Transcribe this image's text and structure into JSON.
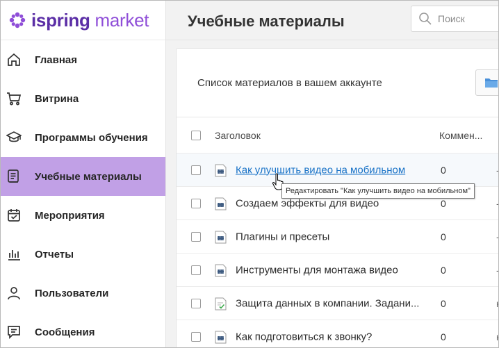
{
  "brand": {
    "logo_part1": "ispring",
    "logo_part2": " market",
    "accent": "#8f4ed8",
    "active_bg": "#c1a0e6",
    "link_color": "#1a73c7"
  },
  "sidebar": {
    "items": [
      {
        "label": "Главная",
        "icon": "home-icon"
      },
      {
        "label": "Витрина",
        "icon": "cart-icon"
      },
      {
        "label": "Программы обучения",
        "icon": "graduation-cap-icon"
      },
      {
        "label": "Учебные материалы",
        "icon": "document-icon",
        "active": true
      },
      {
        "label": "Мероприятия",
        "icon": "calendar-check-icon"
      },
      {
        "label": "Отчеты",
        "icon": "bar-chart-icon"
      },
      {
        "label": "Пользователи",
        "icon": "user-icon"
      },
      {
        "label": "Сообщения",
        "icon": "message-icon"
      }
    ]
  },
  "header": {
    "title": "Учебные материалы",
    "search_placeholder": "Поиск"
  },
  "content": {
    "subtitle": "Список материалов в вашем аккаунте",
    "columns": {
      "title": "Заголовок",
      "comments": "Коммен..."
    },
    "rows": [
      {
        "title": "Как улучшить видео на мобильном",
        "comments": "0",
        "extra": "-",
        "icon": "video-icon",
        "hover": true
      },
      {
        "title": "Создаем эффекты для видео",
        "comments": "0",
        "extra": "-",
        "icon": "video-icon"
      },
      {
        "title": "Плагины и пресеты",
        "comments": "0",
        "extra": "-",
        "icon": "video-icon"
      },
      {
        "title": "Инструменты для монтажа видео",
        "comments": "0",
        "extra": "-",
        "icon": "video-icon"
      },
      {
        "title": "Защита данных в компании. Задани...",
        "comments": "0",
        "extra": "н",
        "icon": "assignment-icon"
      },
      {
        "title": "Как подготовиться к звонку?",
        "comments": "0",
        "extra": "н",
        "icon": "video-icon"
      }
    ]
  },
  "tooltip": {
    "text": "Редактировать \"Как улучшить видео на мобильном\""
  }
}
